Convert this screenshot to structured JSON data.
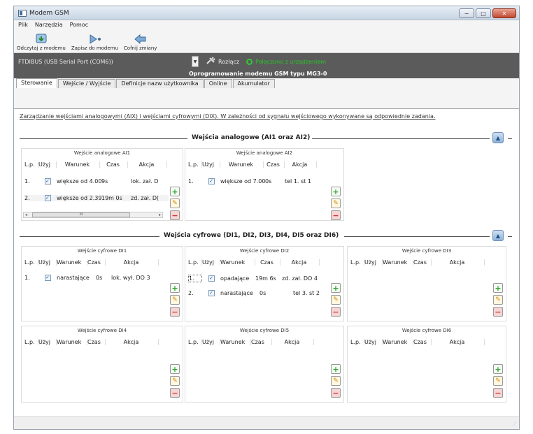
{
  "window": {
    "title": "Modem GSM"
  },
  "menu": [
    "Plik",
    "Narzędzia",
    "Pomoc"
  ],
  "toolbar": {
    "read_label": "Odczytaj z modemu",
    "write_label": "Zapisz do modemu",
    "undo_label": "Cofnij zmiany"
  },
  "connection": {
    "port": "FTDIBUS (USB Serial Port (COM6))",
    "disconnect_label": "Rozłącz",
    "status_text": "Połączono z urządzeniem",
    "firmware": "Oprogramowanie modemu GSM typu MG3-0"
  },
  "tabs": [
    "Sterowanie",
    "Wejście / Wyjście",
    "Definicje nazw użytkownika",
    "Online",
    "Akumulator"
  ],
  "description": "Zarządzanie wejściami analogowymi (AIX) i wejściami cyfrowymi (DIX). W zależności od sygnału wejściowego wykonywane są odpowiednie zadania.",
  "analog_section": {
    "title": "Wejścia analogowe (AI1 oraz AI2)",
    "ai1": {
      "title": "Wejście analogowe AI1",
      "headers": [
        "L.p.",
        "Użyj",
        "Warunek",
        "Czas",
        "Akcja"
      ],
      "rows": [
        {
          "lp": "1.",
          "cond": "większe od 4.00",
          "time": "9s",
          "action": "lok. zał. D"
        },
        {
          "lp": "2.",
          "cond": "większe od 2.39",
          "time": "19m 0s",
          "action": "zd. zał. D("
        }
      ],
      "scroll_thumb": "III"
    },
    "ai2": {
      "title": "Wejście analogowe AI2",
      "headers": [
        "L.p.",
        "Użyj",
        "Warunek",
        "Czas",
        "Akcja"
      ],
      "rows": [
        {
          "lp": "1.",
          "cond": "większe od 7.00",
          "time": "0s",
          "action": "tel 1. st 1"
        }
      ]
    }
  },
  "digital_section": {
    "title": "Wejścia cyfrowe (DI1, DI2, DI3, DI4, DI5 oraz DI6)",
    "headers": [
      "L.p.",
      "Użyj",
      "Warunek",
      "Czas",
      "Akcja"
    ],
    "di1": {
      "title": "Wejście cyfrowe DI1",
      "rows": [
        {
          "lp": "1.",
          "cond": "narastające",
          "time": "0s",
          "action": "lok. wył. DO 3"
        }
      ]
    },
    "di2": {
      "title": "Wejście cyfrowe DI2",
      "rows": [
        {
          "lp": "1.",
          "cond": "opadające",
          "time": "19m 6s",
          "action": "zd. zał. DO 4"
        },
        {
          "lp": "2.",
          "cond": "narastające",
          "time": "0s",
          "action": "tel 3. st 2"
        }
      ]
    },
    "di3": {
      "title": "Wejście cyfrowe DI3",
      "rows": []
    },
    "di4": {
      "title": "Wejście cyfrowe DI4",
      "rows": []
    },
    "di5": {
      "title": "Wejście cyfrowe DI5",
      "rows": []
    },
    "di6": {
      "title": "Wejście cyfrowe DI6",
      "rows": []
    }
  },
  "buttons": {
    "add": "+",
    "edit": "✎",
    "remove": "−",
    "up": "▲",
    "check": "✓"
  },
  "window_buttons": {
    "minimize": "−",
    "maximize": "□",
    "close": "✕"
  }
}
